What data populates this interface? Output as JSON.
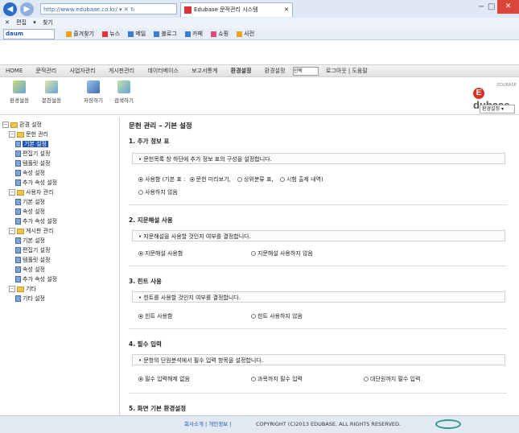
{
  "browser": {
    "address": "http://www.edubase.co.kr/ ▾ ✕ ↻",
    "tab_title": "Edubase 문적관리 시스템",
    "tab_close": "✕",
    "back": "◀",
    "forward": "▶",
    "menu_items": [
      "✕",
      "편집",
      "▾",
      "찾기"
    ],
    "bookmark_search": "daum",
    "bookmarks": [
      "즐겨찾기",
      "뉴스",
      "메일",
      "블로그",
      "카페",
      "쇼핑",
      "사전"
    ],
    "colors": {
      "chrome": "#dfe9f5",
      "accent": "#2b6cc4",
      "close": "#d9473c"
    }
  },
  "app_nav": {
    "items": [
      "HOME",
      "문적관리",
      "사업자관리",
      "게시판관리",
      "데이터베이스",
      "보고서통계",
      "환경설정"
    ],
    "active_index": 6,
    "user_label": "환경설정",
    "select_value": "선택",
    "logout_link": "로그아웃 | 도움말"
  },
  "toolbar": {
    "tools": [
      {
        "label": "환경설정",
        "icon": "settings-icon"
      },
      {
        "label": "문헌설정",
        "icon": "book-settings-icon"
      },
      {
        "label": "저장하기",
        "icon": "save-icon"
      },
      {
        "label": "검색하기",
        "icon": "search-icon"
      }
    ],
    "logo_text": "dubase",
    "logo_letter": "E",
    "logo_sub": "EDUBASE",
    "select_value": "환경설정  ▾"
  },
  "sidebar": {
    "items": [
      {
        "label": "환경 설정",
        "type": "folder",
        "level": 0,
        "expander": "−"
      },
      {
        "label": "문헌 관리",
        "type": "folder",
        "level": 1,
        "expander": "−"
      },
      {
        "label": "기본 설정",
        "type": "doc",
        "level": 2,
        "selected": true
      },
      {
        "label": "편집기 설정",
        "type": "doc",
        "level": 2
      },
      {
        "label": "템플릿 설정",
        "type": "doc",
        "level": 2
      },
      {
        "label": "속성 설정",
        "type": "doc",
        "level": 2
      },
      {
        "label": "추가 속성 설정",
        "type": "doc",
        "level": 2
      },
      {
        "label": "사용자 관리",
        "type": "folder",
        "level": 1,
        "expander": "−"
      },
      {
        "label": "기본 설정",
        "type": "doc",
        "level": 2
      },
      {
        "label": "속성 설정",
        "type": "doc",
        "level": 2
      },
      {
        "label": "추가 속성 설정",
        "type": "doc",
        "level": 2
      },
      {
        "label": "게시판 관리",
        "type": "folder",
        "level": 1,
        "expander": "−"
      },
      {
        "label": "기본 설정",
        "type": "doc",
        "level": 2
      },
      {
        "label": "편집기 설정",
        "type": "doc",
        "level": 2
      },
      {
        "label": "템플릿 설정",
        "type": "doc",
        "level": 2
      },
      {
        "label": "속성 설정",
        "type": "doc",
        "level": 2
      },
      {
        "label": "추가 속성 설정",
        "type": "doc",
        "level": 2
      },
      {
        "label": "기타",
        "type": "folder",
        "level": 1,
        "expander": "−"
      },
      {
        "label": "기타 설정",
        "type": "doc",
        "level": 2
      }
    ]
  },
  "main": {
    "title": "문헌 관리 – 기본 설정",
    "sections": [
      {
        "title": "1. 추가 정보 표",
        "desc": "• 문헌목록 창 하단에 추가 정보 표의 구성을 설정합니다.",
        "options": [
          {
            "label": "사용함 (기본 표 :",
            "on": true
          },
          {
            "label": "문헌 미리보기,",
            "on": true
          },
          {
            "label": "상위분류 표,",
            "on": false
          },
          {
            "label": "시험 출제 내역)",
            "on": false
          }
        ],
        "options2": [
          {
            "label": "사용하지 않음",
            "on": false
          }
        ]
      },
      {
        "title": "2. 지문해설 사용",
        "desc": "• 지문해설을 사용할 것인지 여부를 결정합니다.",
        "options": [
          {
            "label": "지문해설 사용함",
            "on": true
          },
          {
            "label": "지문해설 사용하지 않음",
            "on": false
          }
        ]
      },
      {
        "title": "3. 힌트 사용",
        "desc": "• 힌트를 사용할 것인지 여부를 결정합니다.",
        "options": [
          {
            "label": "힌트 사용함",
            "on": true
          },
          {
            "label": "힌트 사용하지 않음",
            "on": false
          }
        ]
      },
      {
        "title": "4. 필수 입력",
        "desc": "• 문항의 단원분석에서 필수 입력 항목을 설정합니다.",
        "options": [
          {
            "label": "필수 입력해제 없음",
            "on": true
          },
          {
            "label": "과목까지 필수 입력",
            "on": false
          },
          {
            "label": "대단원까지 필수 입력",
            "on": false
          }
        ]
      },
      {
        "title": "5. 화면 기본 환경설정"
      }
    ]
  },
  "footer": {
    "links": "회사소개 | 개인정보 |",
    "copyright": "COPYRIGHT (C)2013 EDUBASE. ALL RIGHTS RESERVED."
  }
}
